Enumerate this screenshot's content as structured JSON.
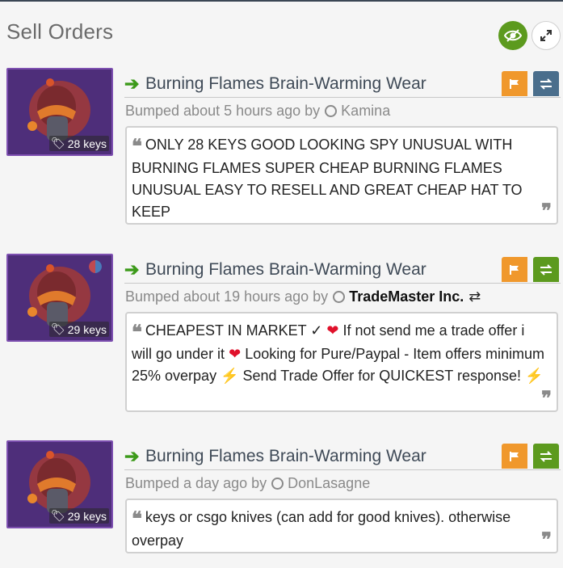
{
  "page": {
    "title": "Sell Orders"
  },
  "colors": {
    "accent_green": "#5c9a1e",
    "flag_orange": "#f0982c",
    "trade_blue": "#4a6e8c",
    "trade_green": "#5c9a1e",
    "quality_purple": "#7d4fb0"
  },
  "icons": {
    "toggle": "eye-slash-icon",
    "expand": "expand-icon",
    "arrow": "arrow-right-icon",
    "flag": "flag-icon",
    "trade": "exchange-icon",
    "price": "tag-icon",
    "status": "circle-icon",
    "quote_open": "quote-left-icon",
    "quote_close": "quote-right-icon"
  },
  "orders": [
    {
      "item_name": "Burning Flames Brain-Warming Wear",
      "price": "28 keys",
      "bumped_prefix": "Bumped about 5 hours ago by",
      "user": "Kamina",
      "message": "ONLY 28 KEYS GOOD LOOKING SPY UNUSUAL WITH BURNING FLAMES SUPER CHEAP BURNING FLAMES UNUSUAL EASY TO RESELL AND GREAT CHEAP HAT TO KEEP"
    },
    {
      "item_name": "Burning Flames Brain-Warming Wear",
      "price": "29 keys",
      "bumped_prefix": "Bumped about 19 hours ago by",
      "user": "TradeMaster Inc.",
      "message_parts": {
        "p1": "CHEAPEST IN MARKET ✓",
        "p2": "If not send me a trade offer i will go under it",
        "p3": "Looking for Pure/Paypal - Item offers minimum 25% overpay",
        "p4": "Send Trade Offer for QUICKEST response!"
      }
    },
    {
      "item_name": "Burning Flames Brain-Warming Wear",
      "price": "29 keys",
      "bumped_prefix": "Bumped a day ago by",
      "user": "DonLasagne",
      "message": "keys or csgo knives (can add for good knives). otherwise overpay"
    }
  ]
}
